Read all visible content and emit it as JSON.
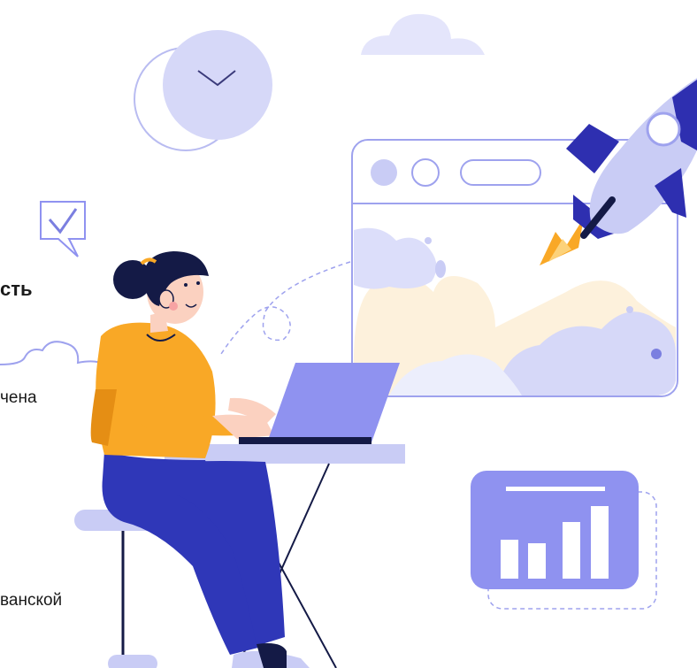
{
  "text_fragments": {
    "heading_fragment": "сть",
    "line1_fragment": "чена",
    "line2_fragment": "ванской"
  },
  "colors": {
    "lavender": "#c9ccf5",
    "outline": "#7b7fe0",
    "screen_bar": "#8f92f0",
    "navy": "#2f37b8",
    "rocket_dark": "#2e2fb0",
    "shirt": "#f9a826",
    "hair": "#141a46",
    "skin": "#fbd1c0",
    "flame": "#f9a826",
    "smoke": "#fdf1dc"
  },
  "icons": [
    "clock-icon",
    "checkmark-icon",
    "rocket-icon",
    "bar-chart-icon",
    "cloud-icon"
  ]
}
